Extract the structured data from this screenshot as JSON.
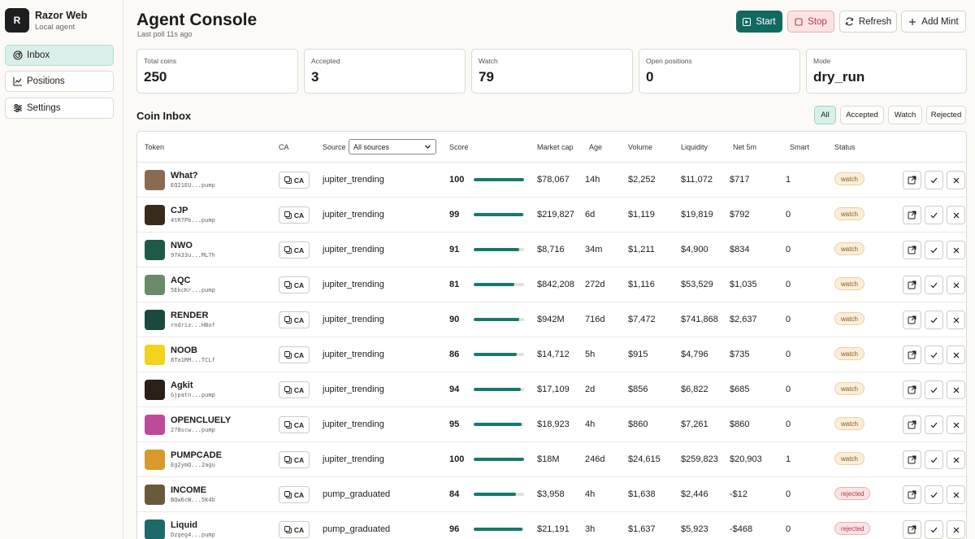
{
  "app": {
    "logo_letter": "R",
    "name": "Razor Web",
    "subtitle": "Local agent"
  },
  "nav": [
    {
      "label": "Inbox",
      "icon": "inbox-radar-icon",
      "active": true
    },
    {
      "label": "Positions",
      "icon": "chart-line-icon",
      "active": false
    },
    {
      "label": "Settings",
      "icon": "sliders-icon",
      "active": false
    }
  ],
  "header": {
    "title": "Agent Console",
    "last_poll": "Last poll 11s ago",
    "start_label": "Start",
    "stop_label": "Stop",
    "refresh_label": "Refresh",
    "add_mint_label": "Add Mint"
  },
  "stats": [
    {
      "label": "Total coins",
      "value": "250"
    },
    {
      "label": "Accepted",
      "value": "3"
    },
    {
      "label": "Watch",
      "value": "79"
    },
    {
      "label": "Open positions",
      "value": "0"
    },
    {
      "label": "Mode",
      "value": "dry_run"
    }
  ],
  "inbox": {
    "title": "Coin Inbox",
    "filters": [
      {
        "label": "All",
        "active": true
      },
      {
        "label": "Accepted",
        "active": false
      },
      {
        "label": "Watch",
        "active": false
      },
      {
        "label": "Rejected",
        "active": false
      }
    ],
    "columns": {
      "token": "Token",
      "ca": "CA",
      "source": "Source",
      "source_filter": "All sources",
      "score": "Score",
      "market_cap": "Market cap",
      "age": "Age",
      "volume": "Volume",
      "liquidity": "Liquidity",
      "net5m": "Net 5m",
      "smart": "Smart",
      "status": "Status"
    },
    "ca_label": "CA",
    "rows": [
      {
        "name": "What?",
        "addr": "EQ21EU...pump",
        "source": "jupiter_trending",
        "score": "100",
        "score_pct": 100,
        "mcap": "$78,067",
        "age": "14h",
        "volume": "$2,252",
        "liquidity": "$11,072",
        "net5m": "$717",
        "smart": "1",
        "status": "watch"
      },
      {
        "name": "CJP",
        "addr": "4tR7Pb...pump",
        "source": "jupiter_trending",
        "score": "99",
        "score_pct": 99,
        "mcap": "$219,827",
        "age": "6d",
        "volume": "$1,119",
        "liquidity": "$19,819",
        "net5m": "$792",
        "smart": "0",
        "status": "watch"
      },
      {
        "name": "NWO",
        "addr": "97A33u...ML7h",
        "source": "jupiter_trending",
        "score": "91",
        "score_pct": 91,
        "mcap": "$8,716",
        "age": "34m",
        "volume": "$1,211",
        "liquidity": "$4,900",
        "net5m": "$834",
        "smart": "0",
        "status": "watch"
      },
      {
        "name": "AQC",
        "addr": "5EkcKr...pump",
        "source": "jupiter_trending",
        "score": "81",
        "score_pct": 81,
        "mcap": "$842,208",
        "age": "272d",
        "volume": "$1,116",
        "liquidity": "$53,529",
        "net5m": "$1,035",
        "smart": "0",
        "status": "watch"
      },
      {
        "name": "RENDER",
        "addr": "rndriz...HBof",
        "source": "jupiter_trending",
        "score": "90",
        "score_pct": 90,
        "mcap": "$942M",
        "age": "716d",
        "volume": "$7,472",
        "liquidity": "$741,868",
        "net5m": "$2,637",
        "smart": "0",
        "status": "watch"
      },
      {
        "name": "NOOB",
        "addr": "8Ta1RM...TCLf",
        "source": "jupiter_trending",
        "score": "86",
        "score_pct": 86,
        "mcap": "$14,712",
        "age": "5h",
        "volume": "$915",
        "liquidity": "$4,796",
        "net5m": "$735",
        "smart": "0",
        "status": "watch"
      },
      {
        "name": "Agkit",
        "addr": "Gjpatn...pump",
        "source": "jupiter_trending",
        "score": "94",
        "score_pct": 94,
        "mcap": "$17,109",
        "age": "2d",
        "volume": "$856",
        "liquidity": "$6,822",
        "net5m": "$685",
        "smart": "0",
        "status": "watch"
      },
      {
        "name": "OPENCLUELY",
        "addr": "278scw...pump",
        "source": "jupiter_trending",
        "score": "95",
        "score_pct": 95,
        "mcap": "$18,923",
        "age": "4h",
        "volume": "$860",
        "liquidity": "$7,261",
        "net5m": "$860",
        "smart": "0",
        "status": "watch"
      },
      {
        "name": "PUMPCADE",
        "addr": "Eg2ymQ...2agu",
        "source": "jupiter_trending",
        "score": "100",
        "score_pct": 100,
        "mcap": "$18M",
        "age": "246d",
        "volume": "$24,615",
        "liquidity": "$259,823",
        "net5m": "$20,903",
        "smart": "1",
        "status": "watch"
      },
      {
        "name": "INCOME",
        "addr": "BQw6cW...5K4b",
        "source": "pump_graduated",
        "score": "84",
        "score_pct": 84,
        "mcap": "$3,958",
        "age": "4h",
        "volume": "$1,638",
        "liquidity": "$2,446",
        "net5m": "-$12",
        "smart": "0",
        "status": "rejected"
      },
      {
        "name": "Liquid",
        "addr": "Dzqeg4...pump",
        "source": "pump_graduated",
        "score": "96",
        "score_pct": 96,
        "mcap": "$21,191",
        "age": "3h",
        "volume": "$1,637",
        "liquidity": "$5,923",
        "net5m": "-$468",
        "smart": "0",
        "status": "rejected"
      }
    ]
  },
  "avatar_colors": [
    "#8a6a52",
    "#3a2a1a",
    "#1f5a48",
    "#6a8a6a",
    "#1a4a3e",
    "#f2d21a",
    "#2a2018",
    "#c04a9a",
    "#d89a2a",
    "#6a5a3a",
    "#1e6a6a"
  ],
  "colors": {
    "accent": "#126a5f",
    "danger": "#b23a45",
    "warning": "#8a5a1c"
  }
}
